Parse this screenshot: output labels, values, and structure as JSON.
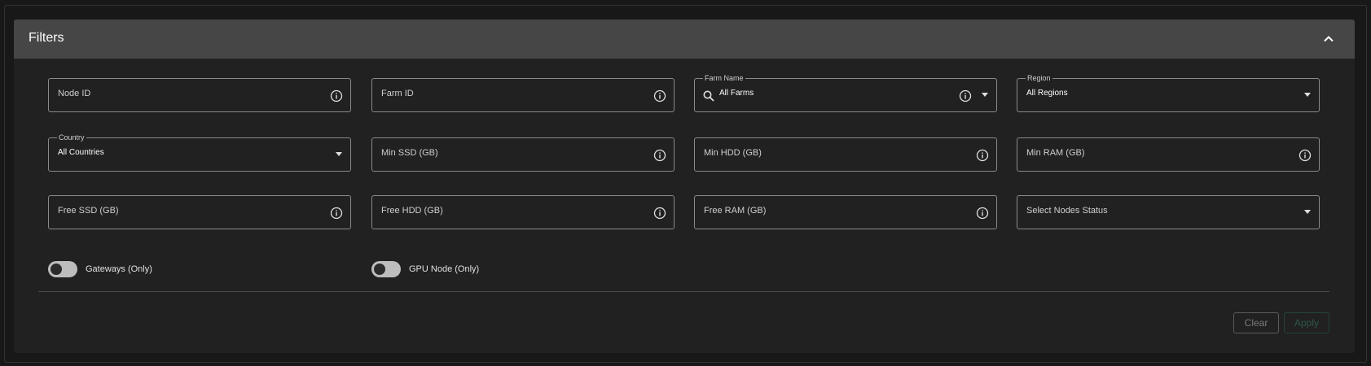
{
  "filters": {
    "title": "Filters",
    "collapse_icon": "chevron-up-icon",
    "fields": {
      "node_id": {
        "label": "Node ID",
        "icon": "info-icon"
      },
      "farm_id": {
        "label": "Farm ID",
        "icon": "info-icon"
      },
      "farm_name": {
        "legend": "Farm Name",
        "value": "All Farms",
        "icons": [
          "search-icon",
          "info-icon",
          "caret-down-icon"
        ]
      },
      "region": {
        "legend": "Region",
        "value": "All Regions",
        "icon": "caret-down-icon"
      },
      "country": {
        "legend": "Country",
        "value": "All Countries",
        "icon": "caret-down-icon"
      },
      "min_ssd": {
        "label": "Min SSD (GB)",
        "icon": "info-icon"
      },
      "min_hdd": {
        "label": "Min HDD (GB)",
        "icon": "info-icon"
      },
      "min_ram": {
        "label": "Min RAM (GB)",
        "icon": "info-icon"
      },
      "free_ssd": {
        "label": "Free SSD (GB)",
        "icon": "info-icon"
      },
      "free_hdd": {
        "label": "Free HDD (GB)",
        "icon": "info-icon"
      },
      "free_ram": {
        "label": "Free RAM (GB)",
        "icon": "info-icon"
      },
      "node_status": {
        "label": "Select Nodes Status",
        "icon": "caret-down-icon"
      }
    },
    "toggles": {
      "gateways": {
        "label": "Gateways (Only)",
        "checked": false
      },
      "gpu": {
        "label": "GPU Node (Only)",
        "checked": false
      }
    },
    "actions": {
      "clear": "Clear",
      "apply": "Apply"
    }
  },
  "colors": {
    "header_bg": "#464646",
    "panel_bg": "#212121",
    "page_bg": "#181818",
    "border": "#8a8a8a",
    "apply_disabled": "#2e5648"
  }
}
